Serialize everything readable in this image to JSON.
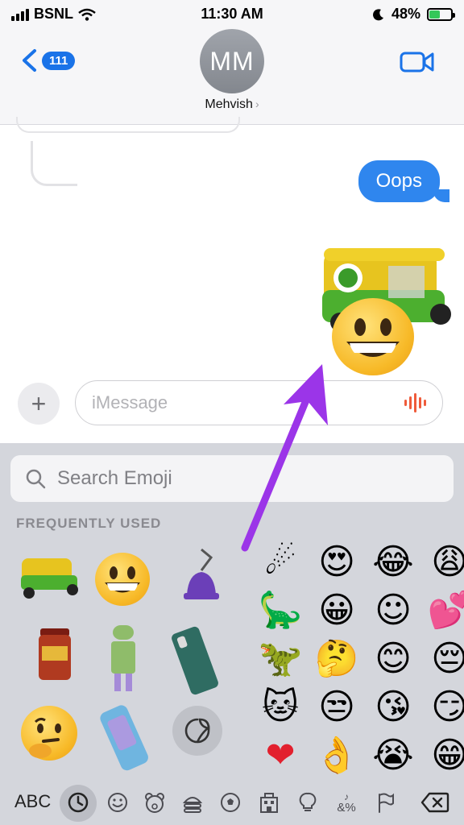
{
  "status_bar": {
    "carrier": "BSNL",
    "time": "11:30 AM",
    "battery_percent": "48%"
  },
  "header": {
    "back_count": "111",
    "avatar_initials": "MM",
    "contact_name": "Mehvish",
    "chevron": "›"
  },
  "conversation": {
    "messages": [
      {
        "from": "me",
        "text": "Oops"
      }
    ]
  },
  "input": {
    "plus": "+",
    "placeholder": "iMessage"
  },
  "emoji_panel": {
    "search_placeholder": "Search Emoji",
    "section_title": "FREQUENTLY USED",
    "emojis": [
      "☄",
      "😍",
      "😂",
      "😩",
      "🦕",
      "😀",
      "☺",
      "💕",
      "🦖",
      "🤔",
      "😊",
      "😔",
      "🐱",
      "😒",
      "😘",
      "😏",
      "❤",
      "👌",
      "😭",
      "😁"
    ],
    "stickers": [
      "auto-rickshaw",
      "grinning-face",
      "bell-keychain",
      "jar",
      "android-figure",
      "phone-case",
      "thinking-face",
      "glitter-case",
      "sticker-peel"
    ]
  },
  "tabbar": {
    "abc_label": "ABC",
    "tabs": [
      "recent-icon",
      "smiley-icon",
      "bear-icon",
      "food-icon",
      "ball-icon",
      "building-icon",
      "bulb-icon",
      "symbols-icon",
      "flag-icon",
      "delete-icon"
    ],
    "symbols_label": "&%"
  },
  "colors": {
    "accent": "#2f86ee",
    "annotation_arrow": "#9b35e8",
    "keyboard_bg": "#d4d6dc"
  }
}
